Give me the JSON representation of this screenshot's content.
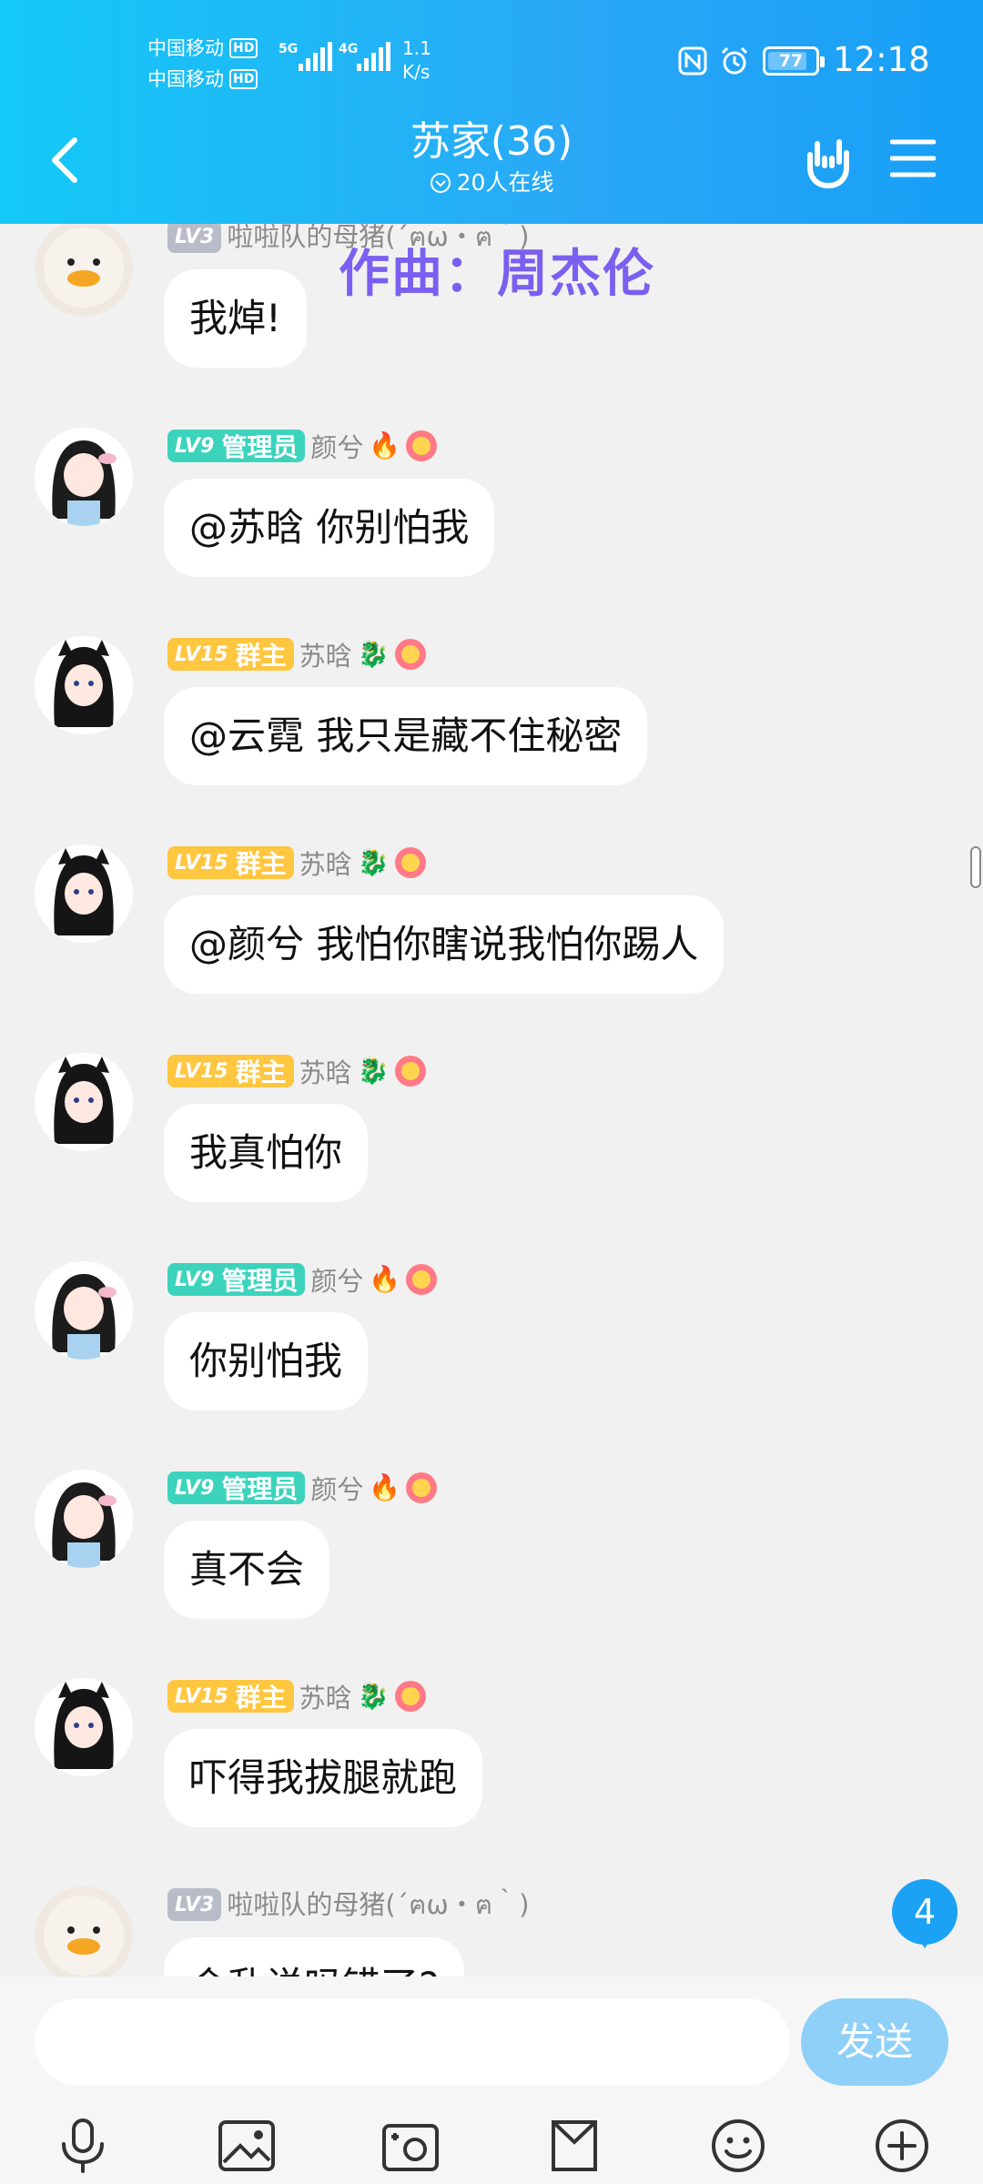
{
  "status": {
    "carrier1": "中国移动",
    "carrier2": "中国移动",
    "hd_badge": "HD",
    "net1": "5G",
    "net2": "4G",
    "speed_value": "1.1",
    "speed_unit": "K/s",
    "battery": "77",
    "time": "12:18"
  },
  "header": {
    "title": "苏家(36)",
    "online": "20人在线"
  },
  "overlay_lyric": "作曲：周杰伦",
  "messages": [
    {
      "level": "LV3",
      "role": "",
      "nick": "啦啦队的母猪(´ฅω・ฅ｀)",
      "text": "我焯!"
    },
    {
      "level": "LV9",
      "role": "管理员",
      "nick": "颜兮",
      "text": "@苏晗 你别怕我"
    },
    {
      "level": "LV15",
      "role": "群主",
      "nick": "苏晗",
      "text": "@云霓 我只是藏不住秘密"
    },
    {
      "level": "LV15",
      "role": "群主",
      "nick": "苏晗",
      "text": "@颜兮 我怕你瞎说我怕你踢人"
    },
    {
      "level": "LV15",
      "role": "群主",
      "nick": "苏晗",
      "text": "我真怕你"
    },
    {
      "level": "LV9",
      "role": "管理员",
      "nick": "颜兮",
      "text": "你别怕我"
    },
    {
      "level": "LV9",
      "role": "管理员",
      "nick": "颜兮",
      "text": "真不会"
    },
    {
      "level": "LV15",
      "role": "群主",
      "nick": "苏晗",
      "text": "吓得我拔腿就跑"
    },
    {
      "level": "LV3",
      "role": "",
      "nick": "啦啦队的母猪(´ฅω・ฅ｀)",
      "text": "会乱说吗错了?"
    }
  ],
  "unread_count": "4",
  "input": {
    "value": "",
    "send_label": "发送"
  },
  "colors": {
    "header_start": "#14c9f7",
    "header_end": "#169ff6",
    "lv_gray": "#b8bcc8",
    "lv_teal": "#3cd3bd",
    "lv_yellow": "#ffc640",
    "send_button": "#8fd0f8",
    "lyric": "#7a5ff0"
  },
  "icons": {
    "back": "chevron-left-icon",
    "hand": "rock-hand-icon",
    "menu": "menu-icon",
    "toolbar": [
      "microphone-icon",
      "image-icon",
      "camera-icon",
      "file-icon",
      "emoji-icon",
      "plus-icon"
    ]
  }
}
